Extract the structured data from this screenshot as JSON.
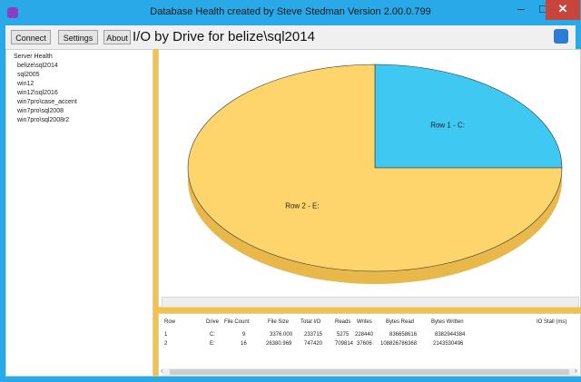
{
  "window": {
    "title": "Database Health created by Steve Stedman Version 2.00.0.799",
    "min_glyph": "–",
    "max_glyph": "□",
    "close_glyph": "✕"
  },
  "toolbar": {
    "connect_label": "Connect",
    "settings_label": "Settings",
    "about_label": "About",
    "page_title": "I/O by Drive for belize\\sql2014"
  },
  "tree": {
    "root": "Server Health",
    "items": [
      "belize\\sql2014",
      "sql2005",
      "win12",
      "win12\\sql2016",
      "win7pro\\case_accent",
      "win7pro\\sql2008",
      "win7pro\\sql2008r2"
    ]
  },
  "chart_data": {
    "type": "pie",
    "slices": [
      {
        "label": "Row 1 - C:",
        "value": 25,
        "color": "#3fc8f2"
      },
      {
        "label": "Row 2 - E:",
        "value": 75,
        "color": "#fdd56c"
      }
    ]
  },
  "grid": {
    "headers": [
      "Row",
      "Drive",
      "File Count",
      "File Size",
      "Total I/O",
      "Reads",
      "Writes",
      "Bytes Read",
      "Bytes Written",
      "IO Stall (ms)"
    ],
    "rows": [
      [
        "1",
        "C:",
        "9",
        "3376.000",
        "233715",
        "5275",
        "228440",
        "836658616",
        "8382944384",
        ""
      ],
      [
        "2",
        "E:",
        "16",
        "26380.969",
        "747420",
        "709814",
        "37606",
        "108826786368",
        "2143530496",
        ""
      ]
    ]
  },
  "scroll": {
    "left": "‹",
    "right": "›"
  }
}
